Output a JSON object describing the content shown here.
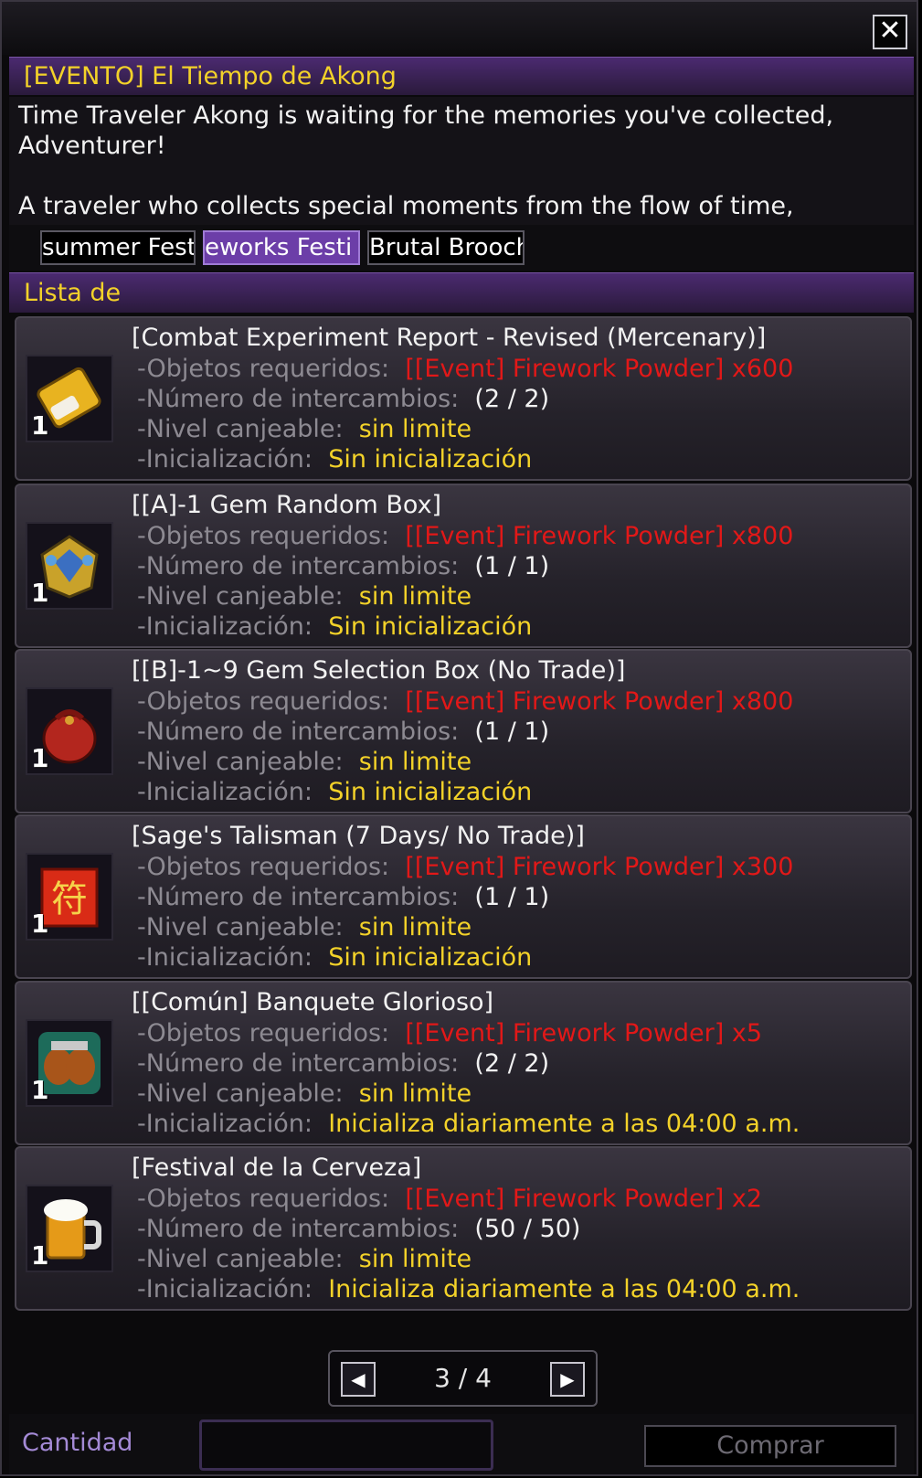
{
  "window": {
    "close_label": "✕"
  },
  "event": {
    "title": "[EVENTO] El Tiempo de Akong",
    "desc_lines": [
      "Time Traveler Akong is waiting for the memories you've collected,",
      "Adventurer!",
      "",
      "A traveler who collects special moments from the flow of time,"
    ]
  },
  "tabs": [
    {
      "label": "summer Festival",
      "active": false
    },
    {
      "label": "eworks Festi",
      "active": true
    },
    {
      "label": "Brutal Brooch",
      "active": false
    }
  ],
  "section": {
    "title": "Lista de"
  },
  "labels": {
    "required": "-Objetos requeridos:",
    "exchanges": "-Número de intercambios:",
    "level": "-Nivel canjeable:",
    "reset": "-Inicialización:"
  },
  "items": [
    {
      "name": "[Combat Experiment Report - Revised (Mercenary)]",
      "qty": "1",
      "icon": "report-scroll-icon",
      "required": "[[Event] Firework Powder] x600",
      "exchanges": "(2 / 2)",
      "level": "sin limite",
      "reset": "Sin inicialización"
    },
    {
      "name": "[[A]-1 Gem Random Box]",
      "qty": "1",
      "icon": "gem-box-icon",
      "required": "[[Event] Firework Powder] x800",
      "exchanges": "(1 / 1)",
      "level": "sin limite",
      "reset": "Sin inicialización"
    },
    {
      "name": "[[B]-1~9 Gem Selection Box (No Trade)]",
      "qty": "1",
      "icon": "red-pouch-icon",
      "required": "[[Event] Firework Powder] x800",
      "exchanges": "(1 / 1)",
      "level": "sin limite",
      "reset": "Sin inicialización"
    },
    {
      "name": "[Sage's Talisman (7 Days/ No Trade)]",
      "qty": "1",
      "icon": "talisman-icon",
      "required": "[[Event] Firework Powder] x300",
      "exchanges": "(1 / 1)",
      "level": "sin limite",
      "reset": "Sin inicialización"
    },
    {
      "name": "[[Común] Banquete Glorioso]",
      "qty": "1",
      "icon": "banquet-icon",
      "required": "[[Event] Firework Powder] x5",
      "exchanges": "(2 / 2)",
      "level": "sin limite",
      "reset": "Inicializa diariamente a las 04:00 a.m."
    },
    {
      "name": "[Festival de la Cerveza]",
      "qty": "1",
      "icon": "beer-mug-icon",
      "required": "[[Event] Firework Powder] x2",
      "exchanges": "(50 / 50)",
      "level": "sin limite",
      "reset": "Inicializa diariamente a las 04:00 a.m."
    }
  ],
  "pager": {
    "text": "3 / 4",
    "prev": "◀",
    "next": "▶"
  },
  "footer": {
    "quantity_label": "Cantidad",
    "quantity_value": "",
    "buy_label": "Comprar"
  },
  "colors": {
    "accent_purple": "#6c3ea8",
    "title_yellow": "#f3d229",
    "required_red": "#e21818",
    "label_gray": "#8d8a92"
  }
}
